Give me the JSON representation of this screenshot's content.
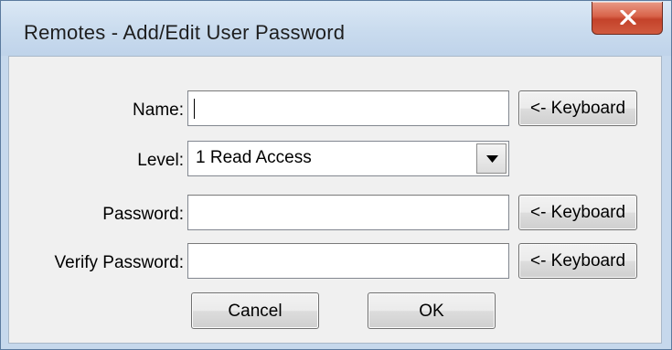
{
  "window": {
    "title": "Remotes - Add/Edit User Password"
  },
  "form": {
    "name": {
      "label": "Name:",
      "value": "",
      "keyboard_label": "<- Keyboard"
    },
    "level": {
      "label": "Level:",
      "selected": "1 Read Access"
    },
    "password": {
      "label": "Password:",
      "value": "",
      "keyboard_label": "<- Keyboard"
    },
    "verify_password": {
      "label": "Verify Password:",
      "value": "",
      "keyboard_label": "<- Keyboard"
    }
  },
  "buttons": {
    "cancel_label": "Cancel",
    "ok_label": "OK"
  },
  "icons": {
    "close": "close-icon",
    "dropdown": "chevron-down-icon"
  },
  "colors": {
    "close_button": "#d05a3f",
    "dialog_background": "#f0f0f0",
    "title_background": "#c9dbee"
  }
}
